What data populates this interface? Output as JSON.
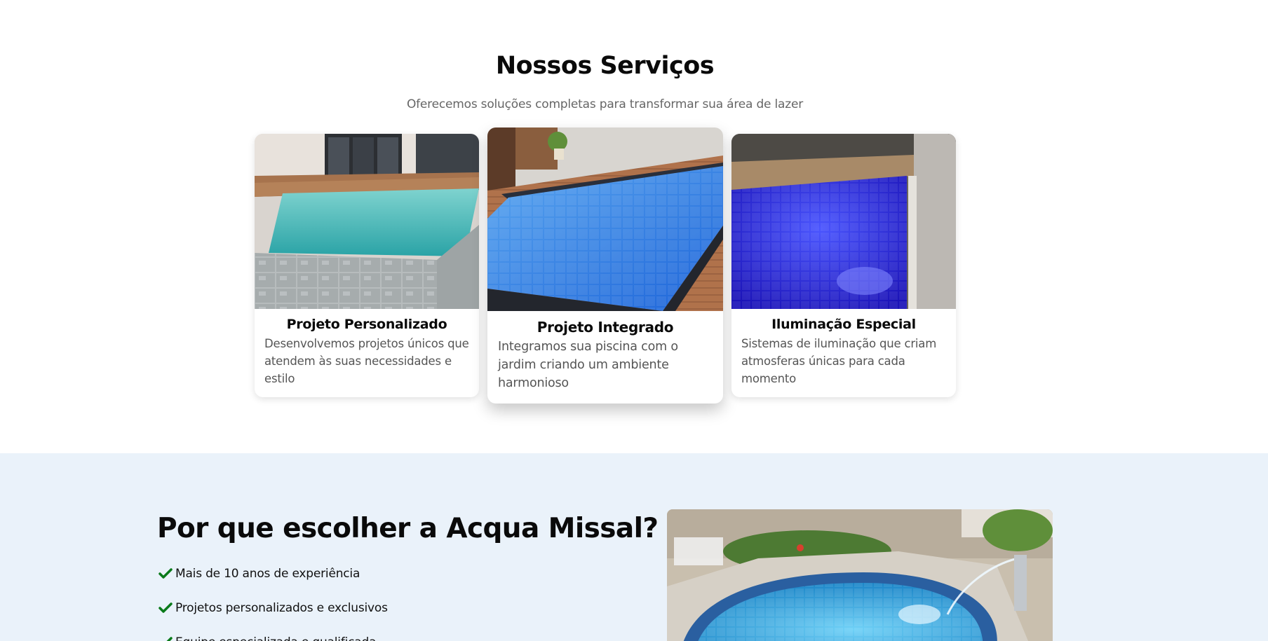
{
  "services": {
    "title": "Nossos Serviços",
    "subtitle": "Oferecemos soluções completas para transformar sua área de lazer",
    "cards": [
      {
        "title": "Projeto Personalizado",
        "description": "Desenvolvemos projetos únicos que atendem às suas necessidades e estilo"
      },
      {
        "title": "Projeto Integrado",
        "description": "Integramos sua piscina com o jardim criando um ambiente harmonioso"
      },
      {
        "title": "Iluminação Especial",
        "description": "Sistemas de iluminação que criam atmosferas únicas para cada momento"
      }
    ]
  },
  "why": {
    "title": "Por que escolher a Acqua Missal?",
    "items": [
      "Mais de 10 anos de experiência",
      "Projetos personalizados e exclusivos",
      "Equipe especializada e qualificada"
    ],
    "check_icon": "check-icon",
    "check_color": "#0a7a1a"
  },
  "colors": {
    "section_alt_bg": "#eaf2fa",
    "text_muted": "#666666"
  }
}
